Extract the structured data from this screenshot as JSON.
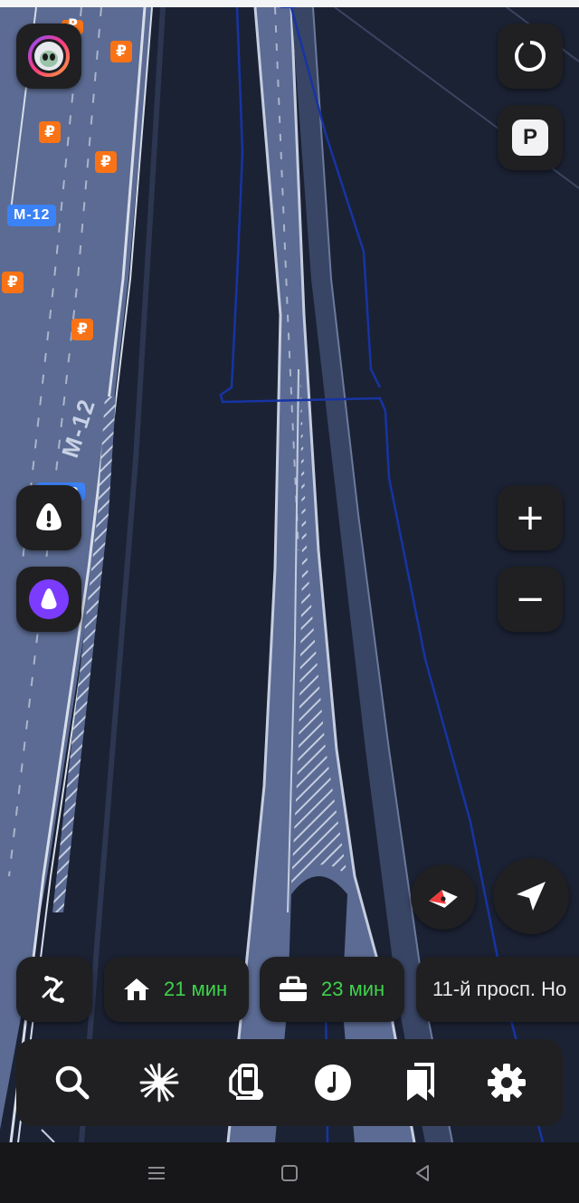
{
  "map": {
    "road_shield_top": "M-12",
    "road_shield_bottom": "M-12",
    "road_name": "M-12",
    "ruble_symbol": "₽",
    "road_color": "#5b6b93",
    "background_color": "#1b2234",
    "boundary_color": "#1734a3"
  },
  "controls": {
    "profile_icon": "profile-avatar-icon",
    "layers_icon": "layers-icon",
    "parking_label": "P",
    "zoom_in": "+",
    "zoom_out": "−",
    "alert_icon": "road-event-icon",
    "alice_icon": "alice-voice-icon",
    "compass_icon": "compass-icon",
    "locate_icon": "my-location-arrow-icon"
  },
  "shortcuts": [
    {
      "icon": "route-options-icon"
    },
    {
      "icon": "home-icon",
      "time": "21 мин"
    },
    {
      "icon": "briefcase-icon",
      "time": "23 мин"
    },
    {
      "address": "11-й просп. Но"
    }
  ],
  "bottom_bar": [
    {
      "icon": "search-icon"
    },
    {
      "icon": "discovery-icon"
    },
    {
      "icon": "fuel-station-icon"
    },
    {
      "icon": "music-icon"
    },
    {
      "icon": "bookmarks-icon"
    },
    {
      "icon": "settings-gear-icon"
    }
  ],
  "accent_colors": {
    "time_green": "#3fd34d",
    "alice_purple": "#7b3cff",
    "ruble_orange": "#f97316",
    "compass_red": "#ef3b3b"
  }
}
